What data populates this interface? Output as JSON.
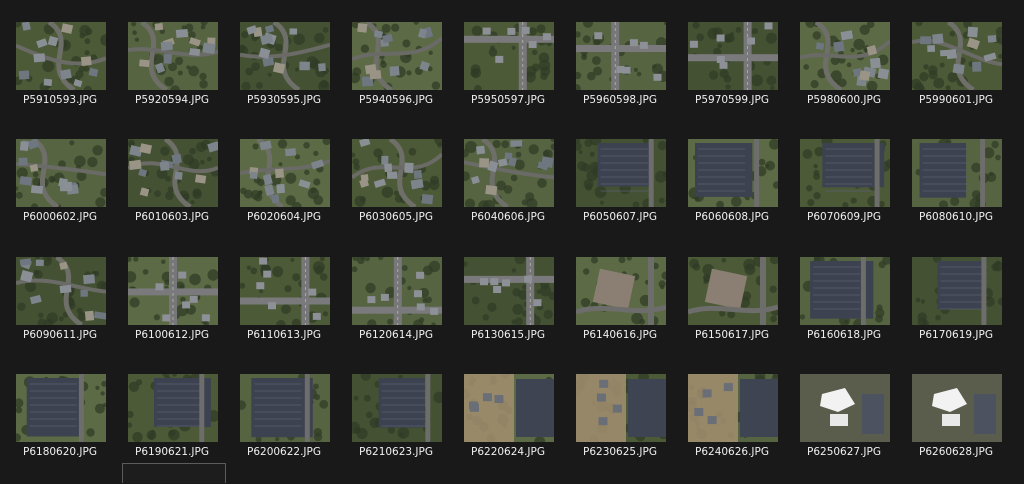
{
  "colors": {
    "background": "#191919",
    "text": "#f0f0f0"
  },
  "files": [
    {
      "name": "P5910593.JPG",
      "scene": "houses"
    },
    {
      "name": "P5920594.JPG",
      "scene": "houses"
    },
    {
      "name": "P5930595.JPG",
      "scene": "houses"
    },
    {
      "name": "P5940596.JPG",
      "scene": "houses"
    },
    {
      "name": "P5950597.JPG",
      "scene": "road"
    },
    {
      "name": "P5960598.JPG",
      "scene": "road"
    },
    {
      "name": "P5970599.JPG",
      "scene": "road"
    },
    {
      "name": "P5980600.JPG",
      "scene": "houses"
    },
    {
      "name": "P5990601.JPG",
      "scene": "houses"
    },
    {
      "name": "P6000602.JPG",
      "scene": "houses"
    },
    {
      "name": "P6010603.JPG",
      "scene": "houses"
    },
    {
      "name": "P6020604.JPG",
      "scene": "houses"
    },
    {
      "name": "P6030605.JPG",
      "scene": "houses"
    },
    {
      "name": "P6040606.JPG",
      "scene": "houses"
    },
    {
      "name": "P6050607.JPG",
      "scene": "lot"
    },
    {
      "name": "P6060608.JPG",
      "scene": "lot"
    },
    {
      "name": "P6070609.JPG",
      "scene": "lot"
    },
    {
      "name": "P6080610.JPG",
      "scene": "lot"
    },
    {
      "name": "P6090611.JPG",
      "scene": "houses"
    },
    {
      "name": "P6100612.JPG",
      "scene": "road"
    },
    {
      "name": "P6110613.JPG",
      "scene": "road"
    },
    {
      "name": "P6120614.JPG",
      "scene": "road"
    },
    {
      "name": "P6130615.JPG",
      "scene": "road"
    },
    {
      "name": "P6140616.JPG",
      "scene": "building"
    },
    {
      "name": "P6150617.JPG",
      "scene": "building"
    },
    {
      "name": "P6160618.JPG",
      "scene": "lot"
    },
    {
      "name": "P6170619.JPG",
      "scene": "lot"
    },
    {
      "name": "P6180620.JPG",
      "scene": "lot"
    },
    {
      "name": "P6190621.JPG",
      "scene": "lot"
    },
    {
      "name": "P6200622.JPG",
      "scene": "lot"
    },
    {
      "name": "P6210623.JPG",
      "scene": "lot"
    },
    {
      "name": "P6220624.JPG",
      "scene": "dirt"
    },
    {
      "name": "P6230625.JPG",
      "scene": "dirt"
    },
    {
      "name": "P6240626.JPG",
      "scene": "dirt"
    },
    {
      "name": "P6250627.JPG",
      "scene": "white"
    },
    {
      "name": "P6260628.JPG",
      "scene": "white"
    }
  ]
}
